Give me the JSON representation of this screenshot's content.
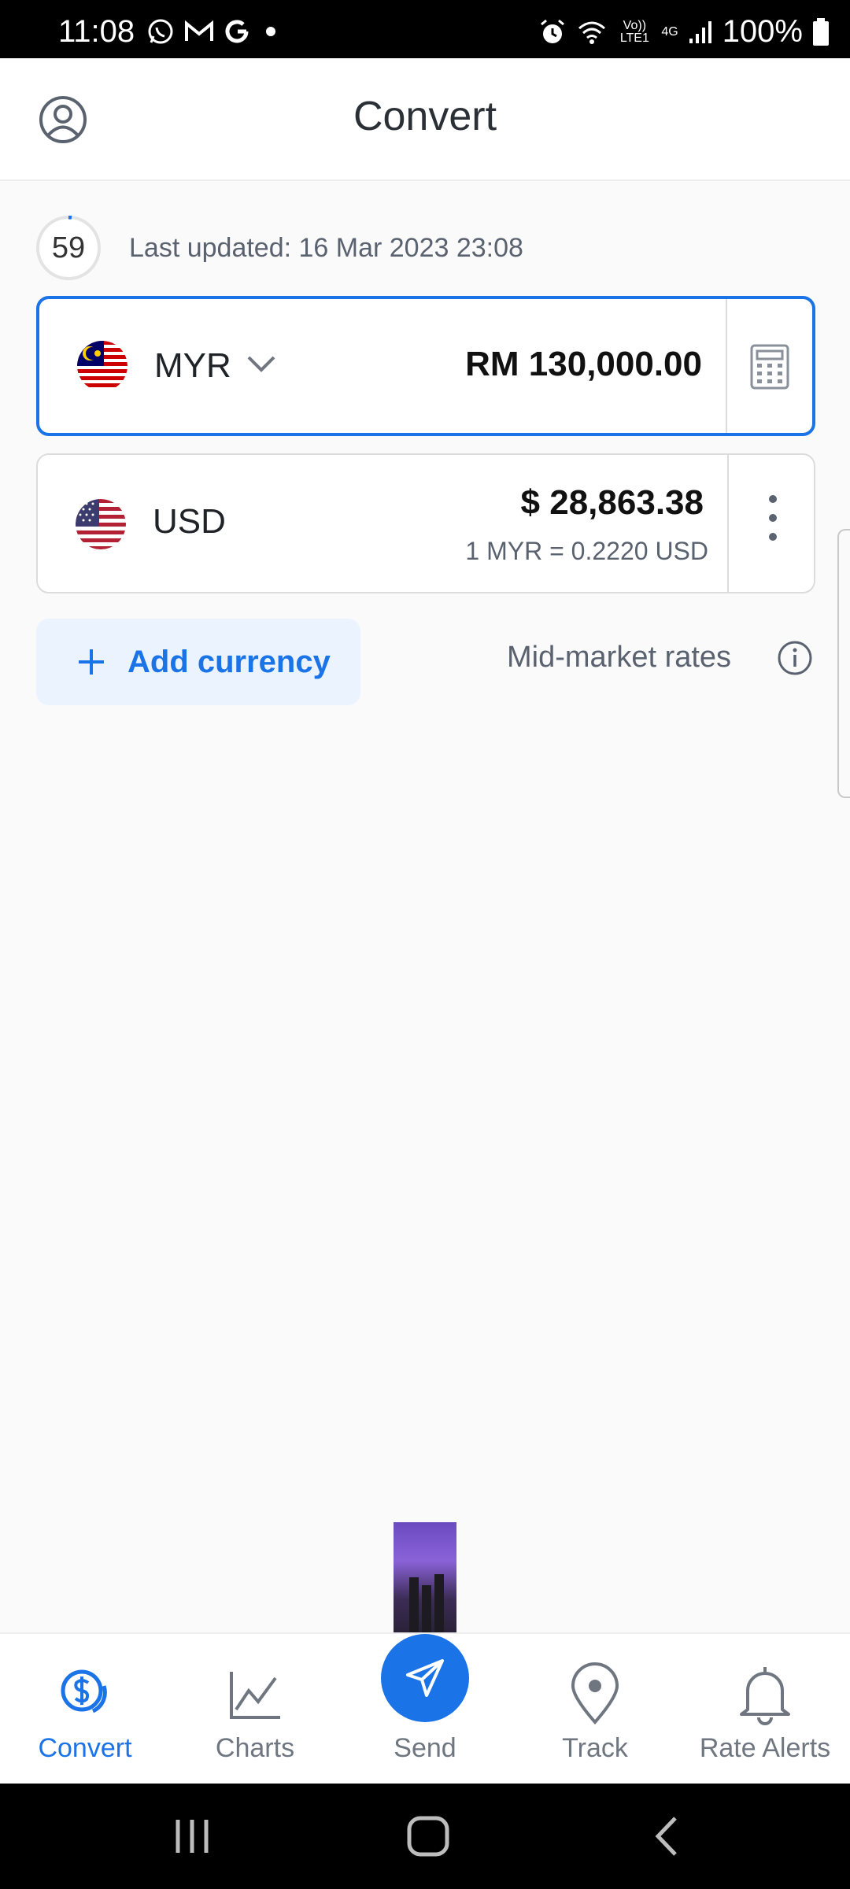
{
  "status_bar": {
    "time": "11:08",
    "battery": "100%",
    "left_icons": [
      "whatsapp-icon",
      "gmail-icon",
      "google-icon",
      "dot-icon"
    ],
    "right_icons": [
      "alarm-icon",
      "wifi-icon",
      "volte-icon",
      "4g-icon",
      "signal-icon",
      "battery-icon"
    ],
    "volte_label": "Vo)) LTE1",
    "network_label": "4G"
  },
  "header": {
    "title": "Convert",
    "profile_icon": "profile-icon"
  },
  "refresh": {
    "countdown": "59",
    "last_updated": "Last updated: 16 Mar 2023 23:08"
  },
  "currencies": [
    {
      "code": "MYR",
      "flag": "malaysia-flag",
      "amount": "RM 130,000.00",
      "selected": true,
      "action_icon": "calculator-icon"
    },
    {
      "code": "USD",
      "flag": "us-flag",
      "amount": "$ 28,863.38",
      "rate": "1 MYR = 0.2220 USD",
      "action_icon": "more-vertical-icon"
    }
  ],
  "add_currency": {
    "label": "Add currency",
    "icon": "plus-icon"
  },
  "mid_market": {
    "label": "Mid-market rates",
    "icon": "info-icon"
  },
  "bottom_nav": [
    {
      "label": "Convert",
      "icon": "currency-convert-icon",
      "active": true
    },
    {
      "label": "Charts",
      "icon": "chart-icon",
      "active": false
    },
    {
      "label": "Send",
      "icon": "send-icon",
      "active": false
    },
    {
      "label": "Track",
      "icon": "location-pin-icon",
      "active": false
    },
    {
      "label": "Rate Alerts",
      "icon": "bell-icon",
      "active": false
    }
  ],
  "colors": {
    "accent": "#1b73e8",
    "add_button_bg": "#eaf3fe",
    "text_secondary": "#5a6270",
    "background": "#fafafa"
  }
}
